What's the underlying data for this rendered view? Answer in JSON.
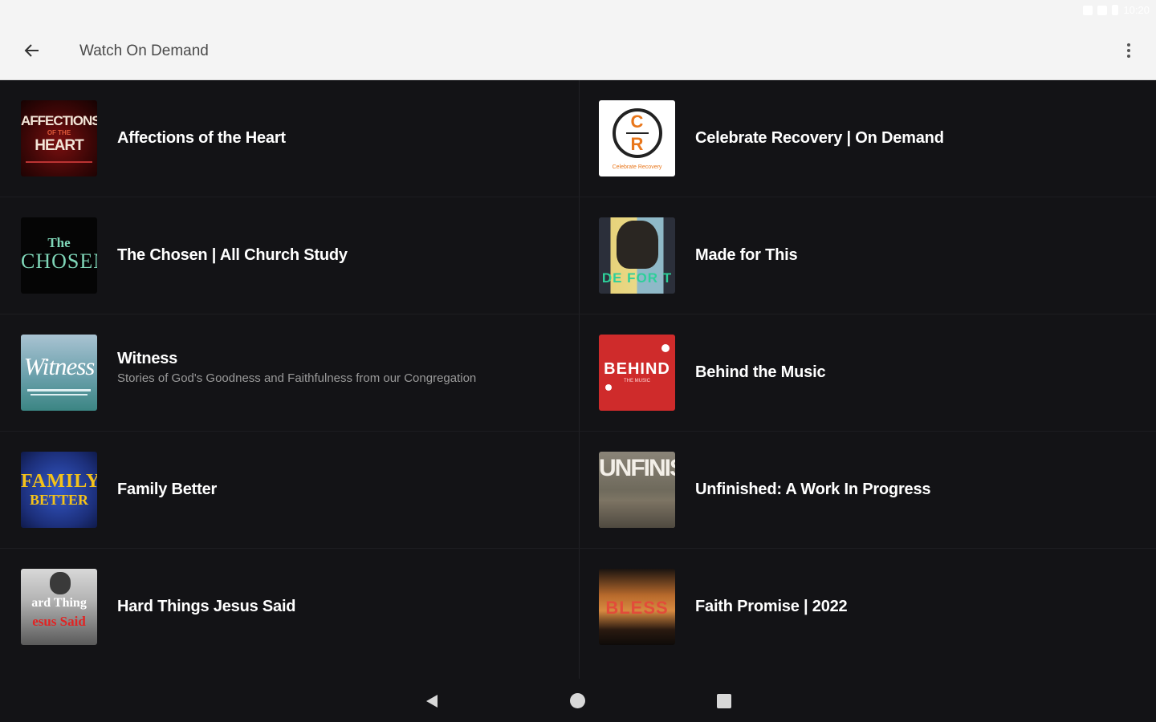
{
  "status_bar": {
    "time": "10:20"
  },
  "app_bar": {
    "title": "Watch On Demand",
    "back_icon": "arrow-left-icon",
    "menu_icon": "more-vert-icon"
  },
  "items": [
    {
      "title": "Affections of the Heart",
      "subtitle": "",
      "thumb_text": "AFFECTIONS",
      "thumb_text2": "HEART"
    },
    {
      "title": "Celebrate Recovery | On Demand",
      "subtitle": "",
      "thumb_text": "C",
      "thumb_text2": "R"
    },
    {
      "title": "The Chosen | All  Church Study",
      "subtitle": "",
      "thumb_text": "The",
      "thumb_text2": "CHOSEN"
    },
    {
      "title": "Made for This",
      "subtitle": "",
      "thumb_text": "DE FOR T",
      "thumb_text2": ""
    },
    {
      "title": "Witness",
      "subtitle": "Stories of God's Goodness and Faithfulness from our Congregation",
      "thumb_text": "Witness",
      "thumb_text2": ""
    },
    {
      "title": "Behind the Music",
      "subtitle": "",
      "thumb_text": "BEHIND",
      "thumb_text2": ""
    },
    {
      "title": "Family Better",
      "subtitle": "",
      "thumb_text": "FAMILY",
      "thumb_text2": "BETTER"
    },
    {
      "title": "Unfinished: A Work In Progress",
      "subtitle": "",
      "thumb_text": "UNFINIS",
      "thumb_text2": ""
    },
    {
      "title": "Hard Things Jesus Said",
      "subtitle": "",
      "thumb_text": "ard Thing",
      "thumb_text2": "esus Said"
    },
    {
      "title": "Faith Promise | 2022",
      "subtitle": "",
      "thumb_text": "BLESS",
      "thumb_text2": ""
    }
  ],
  "nav_bar": {
    "back_icon": "nav-back-icon",
    "home_icon": "nav-home-icon",
    "recents_icon": "nav-recents-icon"
  }
}
